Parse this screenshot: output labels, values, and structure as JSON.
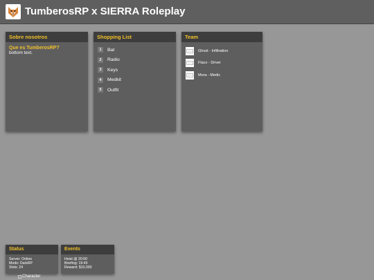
{
  "header": {
    "title": "TumberosRP x SIERRA Roleplay",
    "logo_icon": "fox-face-icon"
  },
  "about": {
    "title": "Sobre nosotros",
    "heading": "Que es TumberosRP?",
    "text": "bottom text."
  },
  "shopping": {
    "title": "Shopping List",
    "items": [
      {
        "num": "1",
        "label": "Bat"
      },
      {
        "num": "2",
        "label": "Radio"
      },
      {
        "num": "3",
        "label": "Keys"
      },
      {
        "num": "4",
        "label": "Medkit"
      },
      {
        "num": "5",
        "label": "Outfit"
      }
    ]
  },
  "team": {
    "title": "Team",
    "members": [
      {
        "label": "Ghost - Infiltration",
        "icon": "broken-image-icon"
      },
      {
        "label": "Flaco - Driver",
        "icon": "broken-image-icon"
      },
      {
        "label": "Mora - Medic",
        "icon": "broken-image-icon"
      }
    ]
  },
  "status": {
    "title": "Status",
    "lines": [
      "Server: Online",
      "Modo: DarkRP",
      "Slots: 24"
    ]
  },
  "events": {
    "title": "Events",
    "lines": [
      "Heist @ 20:00",
      "Briefing: 19:45",
      "Reward: $10,000"
    ]
  },
  "character": {
    "alt": "Character"
  },
  "colors": {
    "accent": "#f0c02b",
    "background": "#979797",
    "panel": "#5e5e5e",
    "panel_header": "#3d3d3d"
  }
}
